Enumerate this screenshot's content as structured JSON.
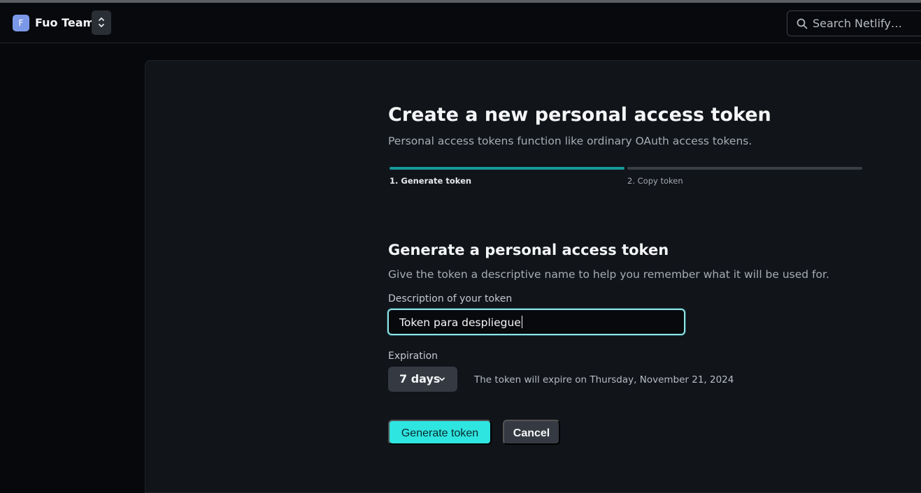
{
  "header": {
    "team_initial": "F",
    "team_name": "Fuo Team",
    "switch_glyph": "⌃⌄",
    "search_placeholder": "Search Netlify…"
  },
  "page": {
    "title": "Create a new personal access token",
    "subtitle": "Personal access tokens function like ordinary OAuth access tokens.",
    "steps": [
      {
        "label": "1. Generate token",
        "state": "active"
      },
      {
        "label": "2. Copy token",
        "state": "upcoming"
      }
    ]
  },
  "form": {
    "section_title": "Generate a personal access token",
    "section_desc": "Give the token a descriptive name to help you remember what it will be used for.",
    "description_label": "Description of your token",
    "description_value": "Token para despliegue",
    "expiration_label": "Expiration",
    "expiration_value": "7 days",
    "expiration_note": "The token will expire on Thursday, November 21, 2024",
    "generate_label": "Generate token",
    "cancel_label": "Cancel"
  },
  "icons": {
    "search": "search-icon",
    "chevron": "chevron-down-icon",
    "team_switch": "chevron-up-down-icon"
  },
  "colors": {
    "accent": "#2ee5e0",
    "step_active": "#17999a",
    "focus_ring": "#8fe3e7",
    "team_avatar": "#7b98e8"
  }
}
